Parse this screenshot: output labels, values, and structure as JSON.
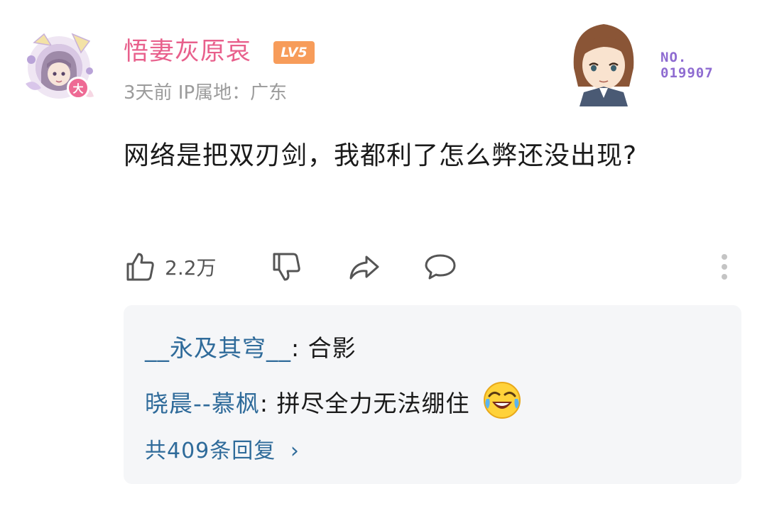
{
  "comment": {
    "username": "悟妻灰原哀",
    "level_badge": "LV5",
    "level_dot": "大",
    "meta": "3天前 IP属地：广东",
    "fan_card_number": "NO.\n019907",
    "fan_card_no_label": "NO.",
    "fan_card_digits": "019907",
    "text": "网络是把双刃剑，我都利了怎么弊还没出现?",
    "like_count": "2.2万"
  },
  "replies": [
    {
      "user": "__永及其穹__",
      "sep": ": ",
      "text": "合影"
    },
    {
      "user": "晓晨--慕枫",
      "sep": ": ",
      "text": "拼尽全力无法绷住",
      "emoji": "laughing-crying-emoji"
    }
  ],
  "replies_more": "共409条回复",
  "colors": {
    "username": "#e8608c",
    "link": "#2f6b9a",
    "badge": "#f79c5a",
    "fan_card_text": "#8e6bd1",
    "reply_bg": "#f5f6f8"
  },
  "icons": [
    "thumbs-up-icon",
    "thumbs-down-icon",
    "share-icon",
    "comment-icon",
    "more-vertical-icon"
  ]
}
